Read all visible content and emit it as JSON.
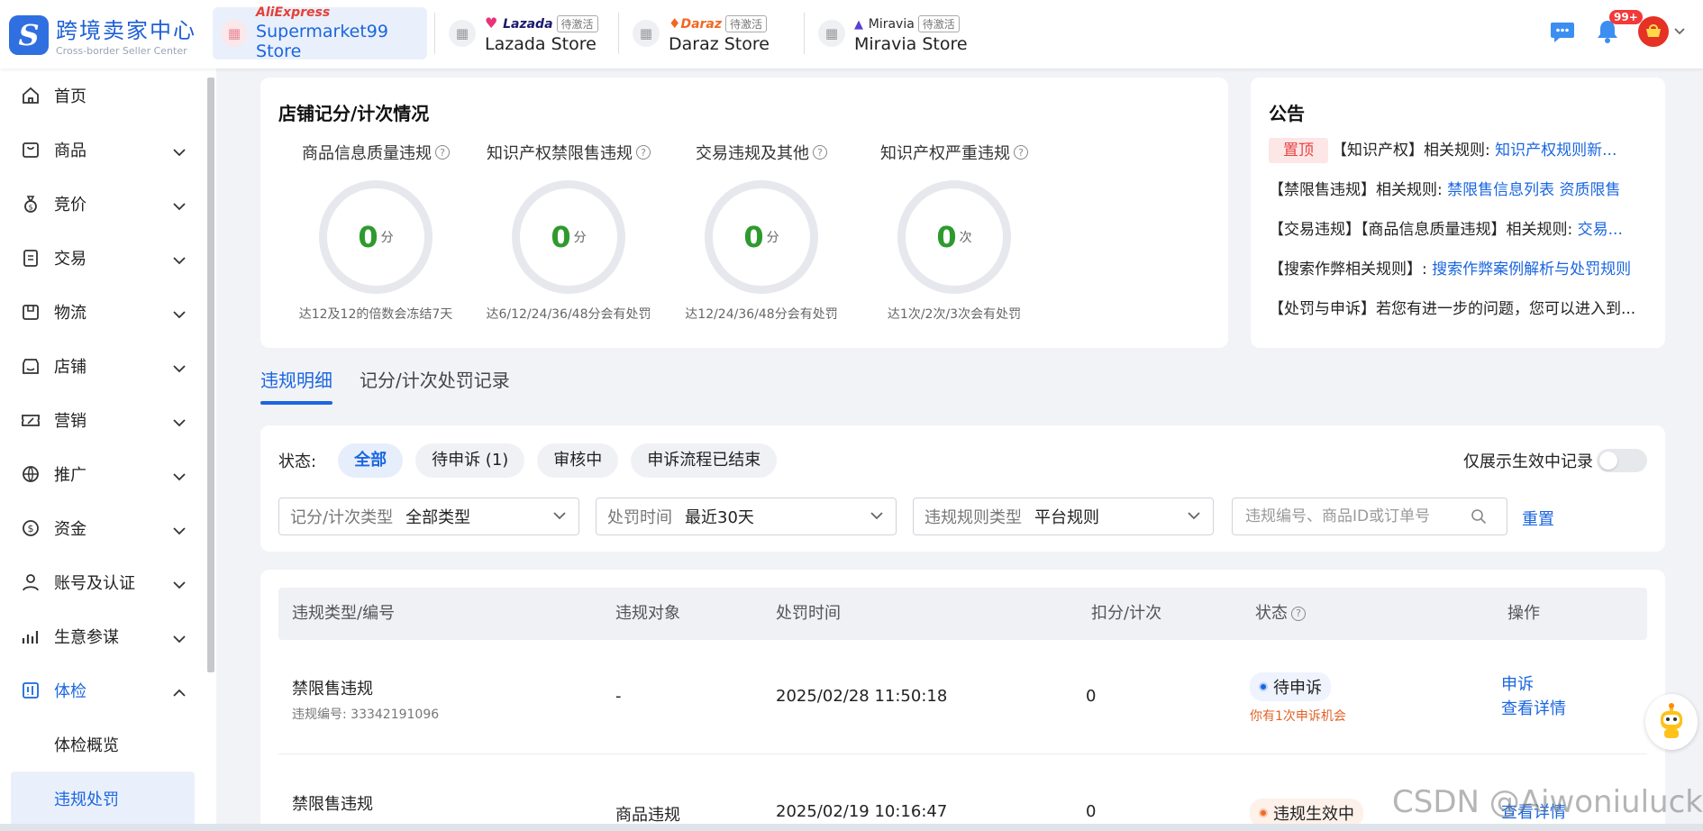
{
  "app": {
    "logo_letter": "S",
    "logo_cn": "跨境卖家中心",
    "logo_en": "Cross-border Seller Center"
  },
  "stores": [
    {
      "brand": "AliExpress",
      "name": "Supermarket99 Store",
      "tag": "",
      "brand_color": "#e5403a",
      "active": true
    },
    {
      "brand": "Lazada",
      "name": "Lazada Store",
      "tag": "待激活",
      "brand_color": "#1a1a6e",
      "active": false
    },
    {
      "brand": "Daraz",
      "name": "Daraz Store",
      "tag": "待激活",
      "brand_color": "#f26722",
      "active": false
    },
    {
      "brand": "Miravia",
      "name": "Miravia Store",
      "tag": "待激活",
      "brand_color": "#2a2a2a",
      "active": false
    }
  ],
  "header_right": {
    "badge": "99+"
  },
  "sidebar": {
    "items": [
      {
        "label": "首页",
        "icon": "home-icon"
      },
      {
        "label": "商品",
        "icon": "bag-icon"
      },
      {
        "label": "竞价",
        "icon": "money-bag-icon"
      },
      {
        "label": "交易",
        "icon": "clipboard-icon"
      },
      {
        "label": "物流",
        "icon": "box-icon"
      },
      {
        "label": "店铺",
        "icon": "store-icon"
      },
      {
        "label": "营销",
        "icon": "ticket-icon"
      },
      {
        "label": "推广",
        "icon": "globe-icon"
      },
      {
        "label": "资金",
        "icon": "dollar-icon"
      },
      {
        "label": "账号及认证",
        "icon": "user-icon"
      },
      {
        "label": "生意参谋",
        "icon": "analytics-icon"
      },
      {
        "label": "体检",
        "icon": "health-check-icon"
      }
    ],
    "sub_items": [
      {
        "label": "体检概览"
      },
      {
        "label": "违规处罚"
      }
    ]
  },
  "score_card": {
    "title": "店铺记分/计次情况",
    "gauges": [
      {
        "title": "商品信息质量违规",
        "value": "0",
        "unit": "分",
        "hint": "达12及12的倍数会冻结7天"
      },
      {
        "title": "知识产权禁限售违规",
        "value": "0",
        "unit": "分",
        "hint": "达6/12/24/36/48分会有处罚"
      },
      {
        "title": "交易违规及其他",
        "value": "0",
        "unit": "分",
        "hint": "达12/24/36/48分会有处罚"
      },
      {
        "title": "知识产权严重违规",
        "value": "0",
        "unit": "次",
        "hint": "达1次/2次/3次会有处罚"
      }
    ]
  },
  "notice_card": {
    "title": "公告",
    "pin": "置顶",
    "lines": [
      {
        "text": "【知识产权】相关规则: ",
        "link": "知识产权规则新..."
      },
      {
        "text": "【禁限售违规】相关规则: ",
        "link": "禁限售信息列表  资质限售"
      },
      {
        "text": "【交易违规】【商品信息质量违规】相关规则: ",
        "link": "交易..."
      },
      {
        "text": "【搜索作弊相关规则】: ",
        "link": "搜索作弊案例解析与处罚规则"
      },
      {
        "text": "【处罚与申诉】若您有进一步的问题，您可以进入到...",
        "link": ""
      }
    ]
  },
  "tabs": [
    {
      "label": "违规明细",
      "active": true
    },
    {
      "label": "记分/计次处罚记录",
      "active": false
    }
  ],
  "filters": {
    "status_label": "状态:",
    "status_pills": [
      {
        "label": "全部",
        "active": true
      },
      {
        "label": "待申诉 (1)",
        "active": false
      },
      {
        "label": "审核中",
        "active": false
      },
      {
        "label": "申诉流程已结束",
        "active": false
      }
    ],
    "toggle_label": "仅展示生效中记录",
    "toggle_on": false,
    "selects": [
      {
        "label": "记分/计次类型",
        "value": "全部类型"
      },
      {
        "label": "处罚时间",
        "value": "最近30天"
      },
      {
        "label": "违规规则类型",
        "value": "平台规则"
      }
    ],
    "search_placeholder": "违规编号、商品ID或订单号",
    "reset_label": "重置"
  },
  "table": {
    "headers": [
      "违规类型/编号",
      "违规对象",
      "处罚时间",
      "扣分/计次",
      "状态",
      "操作"
    ],
    "rows": [
      {
        "type": "禁限售违规",
        "id": "违规编号: 33342191096",
        "object": "-",
        "time": "2025/02/28 11:50:18",
        "score": "0",
        "status": "待申诉",
        "status_color": "blue",
        "warn": "你有1次申诉机会",
        "actions": [
          "申诉",
          "查看详情"
        ]
      },
      {
        "type": "禁限售违规",
        "id": "",
        "object": "商品违规",
        "time": "2025/02/19 10:16:47",
        "score": "0",
        "status": "违规生效中",
        "status_color": "orange",
        "warn": "",
        "actions": [
          "查看详情"
        ]
      }
    ]
  },
  "watermark": "CSDN @Aiwoniulucky"
}
